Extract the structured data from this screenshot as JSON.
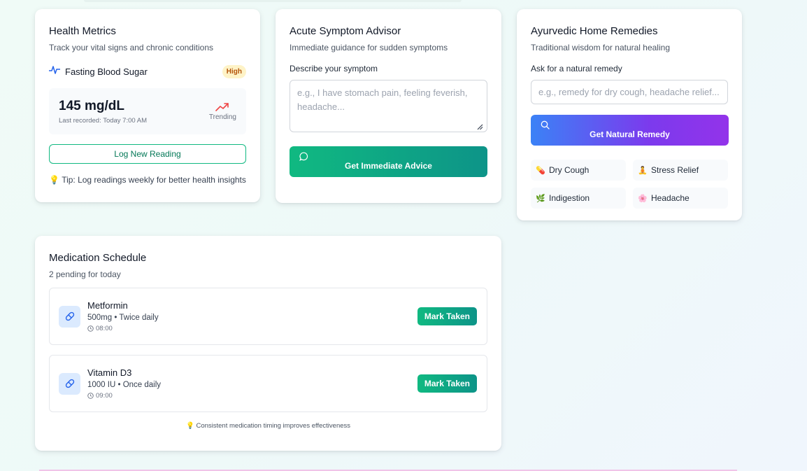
{
  "health": {
    "title": "Health Metrics",
    "subtitle": "Track your vital signs and chronic conditions",
    "metric_name": "Fasting Blood Sugar",
    "badge": "High",
    "value": "145 mg/dL",
    "recorded": "Last recorded: Today 7:00 AM",
    "trend_label": "Trending",
    "button": "Log New Reading",
    "tip": "Tip: Log readings weekly for better health insights",
    "tip_icon": "lightbulb-icon"
  },
  "acute": {
    "title": "Acute Symptom Advisor",
    "subtitle": "Immediate guidance for sudden symptoms",
    "label": "Describe your symptom",
    "placeholder": "e.g., I have stomach pain, feeling feverish, headache...",
    "button": "Get Immediate Advice"
  },
  "ayur": {
    "title": "Ayurvedic Home Remedies",
    "subtitle": "Traditional wisdom for natural healing",
    "label": "Ask for a natural remedy",
    "placeholder": "e.g., remedy for dry cough, headache relief...",
    "button": "Get Natural Remedy",
    "chips": [
      {
        "label": "Dry Cough",
        "icon": "pill-emoji",
        "glyph": "💊"
      },
      {
        "label": "Stress Relief",
        "icon": "meditation-emoji",
        "glyph": "🧘"
      },
      {
        "label": "Indigestion",
        "icon": "leaf-emoji",
        "glyph": "🌿"
      },
      {
        "label": "Headache",
        "icon": "flower-emoji",
        "glyph": "🌸"
      }
    ]
  },
  "meds": {
    "title": "Medication Schedule",
    "subtitle": "2 pending for today",
    "items": [
      {
        "name": "Metformin",
        "dose": "500mg • Twice daily",
        "time": "08:00",
        "button": "Mark Taken"
      },
      {
        "name": "Vitamin D3",
        "dose": "1000 IU • Once daily",
        "time": "09:00",
        "button": "Mark Taken"
      }
    ],
    "tip": "Consistent medication timing improves effectiveness"
  },
  "colors": {
    "accent_green": "#10b981",
    "accent_teal": "#0d9488",
    "accent_purple": "#7c3aed",
    "accent_blue": "#3b82f6",
    "badge_bg": "#fef3c7",
    "badge_text": "#b45309",
    "trend_red": "#ef4444"
  }
}
